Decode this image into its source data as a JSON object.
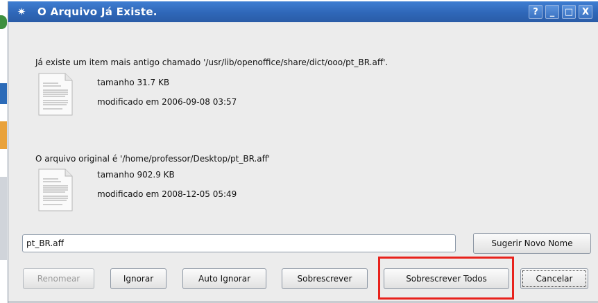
{
  "window": {
    "title": "O Arquivo Já Existe.",
    "controls": [
      "?",
      "_",
      "□",
      "X"
    ]
  },
  "existing": {
    "message": "Já existe um item mais antigo chamado '/usr/lib/openoffice/share/dict/ooo/pt_BR.aff'.",
    "size": "tamanho 31.7 KB",
    "modified": "modificado em 2006-09-08 03:57"
  },
  "original": {
    "message": "O arquivo original é '/home/professor/Desktop/pt_BR.aff'",
    "size": "tamanho 902.9 KB",
    "modified": "modificado em 2008-12-05 05:49"
  },
  "rename": {
    "value": "pt_BR.aff",
    "suggest_label": "Sugerir Novo Nome"
  },
  "buttons": {
    "rename": "Renomear",
    "skip": "Ignorar",
    "auto_skip": "Auto Ignorar",
    "overwrite": "Sobrescrever",
    "overwrite_all": "Sobrescrever Todos",
    "cancel": "Cancelar"
  },
  "colors": {
    "titlebar": "#2f67b8",
    "highlight": "#e8221c"
  }
}
